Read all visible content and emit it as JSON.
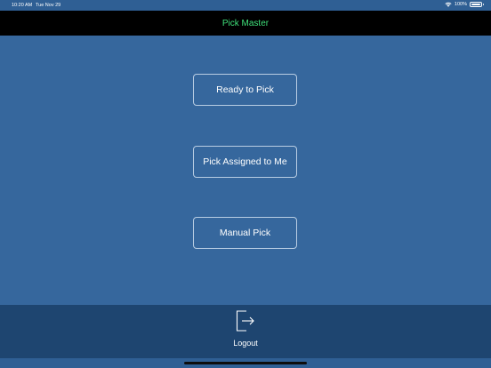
{
  "status_bar": {
    "time": "10:20 AM",
    "date": "Tue Nov 29",
    "battery": "100%",
    "battery_level": 1.0
  },
  "nav_bar": {
    "title": "Pick Master",
    "title_color": "#3fe07a"
  },
  "menu": {
    "ready_to_pick": "Ready to Pick",
    "pick_assigned_to_me": "Pick Assigned to Me",
    "manual_pick": "Manual Pick"
  },
  "bottom_bar": {
    "logout_label": "Logout",
    "logout_icon": "logout-icon"
  },
  "colors": {
    "background": "#36679d",
    "bottom_bar": "#1e4570",
    "nav_bar": "#000000",
    "button_border": "#b9cde3"
  }
}
